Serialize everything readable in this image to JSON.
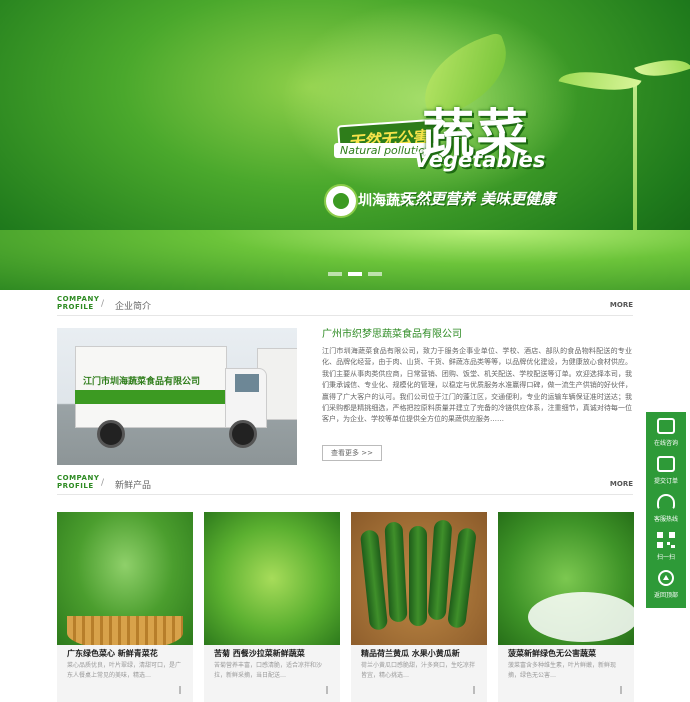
{
  "banner": {
    "badge": "天然无公害",
    "natural": "Natural pollution",
    "title_cn": "蔬菜",
    "title_en": "Vegetables",
    "brand": "圳海蔬菜",
    "slogan": "天然更营养 美味更健康",
    "slide_count": 3,
    "active_slide": 2
  },
  "profile_section": {
    "en": "COMPANY PROFILE",
    "slash": "/",
    "cn": "企业简介",
    "more": "MORE"
  },
  "company": {
    "truck_text": "江门市圳海蔬菜食品有限公司",
    "name": "广州市织梦思蔬菜食品有限公司",
    "desc": "江门市圳海蔬菜食品有限公司，致力于服务企事业单位、学校、酒店、部队的食品物料配送的专业化、品牌化经营，由于肉、山货、干货、鲜蔬冻品类等等，以品牌优化建设，为健康放心食材供应。我们主要从事肉类供应商，日常营销、团购、饭堂、机关配送、学校配送等订单。欢迎选择本司，我们秉承诚信、专业化、规模化的管理，以稳定与优质服务水准赢得口碑，做一流生产供销的好伙伴，赢得了广大客户的认可。我们公司位于江门的蓬江区，交通便利，专业的运输车辆保证准时送达；我们采购都是精挑细选，严格把控原料质量并建立了完备的冷链供应体系，注重细节，真诚对待每一位客户，为企业、学校等单位提供全方位的果蔬供应服务……",
    "read_more": "查看更多 >>"
  },
  "products_section": {
    "en": "COMPANY PROFILE",
    "slash": "/",
    "cn": "新鲜产品",
    "more": "MORE"
  },
  "products": [
    {
      "name": "广东绿色菜心 新鲜青菜花",
      "desc": "菜心品质优良，叶片翠绿，清甜可口，是广东人餐桌上常见的美味，精选…"
    },
    {
      "name": "苦菊 西餐沙拉菜新鲜蔬菜",
      "desc": "苦菊营养丰富，口感清脆，适合凉拌和沙拉，新鲜采摘，当日配送…"
    },
    {
      "name": "精品荷兰黄瓜 水果小黄瓜新",
      "desc": "荷兰小黄瓜口感脆甜，汁多爽口，生吃凉拌皆宜，精心挑选…"
    },
    {
      "name": "菠菜新鲜绿色无公害蔬菜",
      "desc": "菠菜富含多种维生素，叶片鲜嫩，新鲜现摘，绿色无公害…"
    }
  ],
  "float_bar": [
    {
      "label": "在线咨询",
      "icon": "chat-icon"
    },
    {
      "label": "提交订单",
      "icon": "order-icon"
    },
    {
      "label": "客服热线",
      "icon": "headset-icon"
    },
    {
      "label": "扫一扫",
      "icon": "qrcode-icon"
    },
    {
      "label": "返回顶部",
      "icon": "back-to-top-icon"
    }
  ]
}
